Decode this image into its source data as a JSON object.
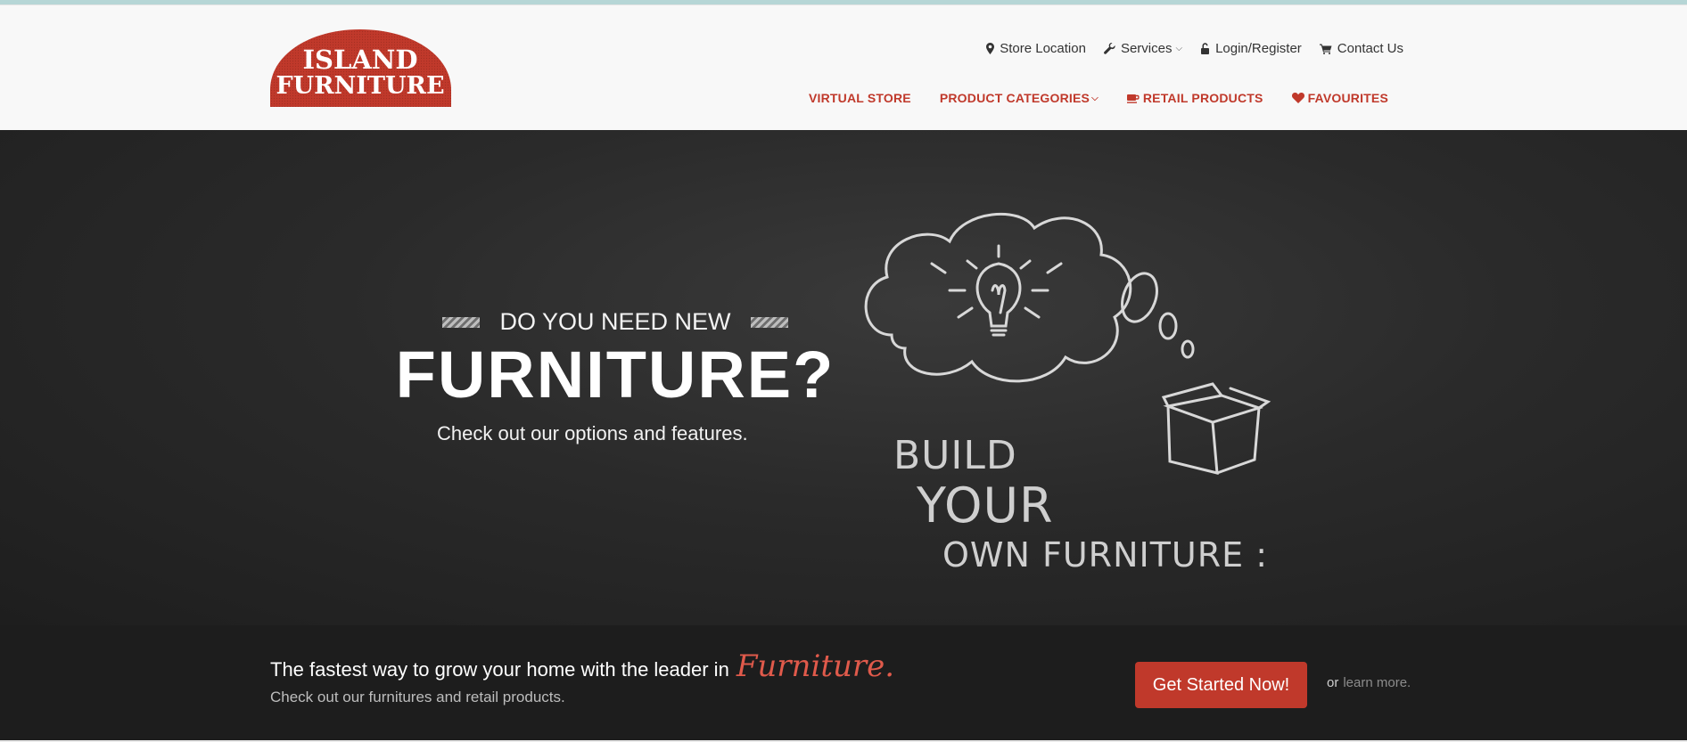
{
  "brand": {
    "logo_line1": "ISLAND",
    "logo_line2": "FURNITURE",
    "color": "#c0392b"
  },
  "utility_nav": [
    {
      "label": "Store Location",
      "icon": "map-marker-icon"
    },
    {
      "label": "Services",
      "icon": "wrench-icon",
      "has_dropdown": true
    },
    {
      "label": "Login/Register",
      "icon": "unlock-icon"
    },
    {
      "label": "Contact Us",
      "icon": "cart-icon"
    }
  ],
  "main_nav": [
    {
      "label": "VIRTUAL STORE"
    },
    {
      "label": "PRODUCT CATEGORIES",
      "has_dropdown": true
    },
    {
      "label": "RETAIL PRODUCTS",
      "icon": "coffee-cup-icon"
    },
    {
      "label": "FAVOURITES",
      "icon": "heart-icon"
    }
  ],
  "hero": {
    "eyebrow": "DO YOU NEED NEW",
    "headline": "FURNITURE?",
    "subline": "Check out our options and features.",
    "build_line1": "BUILD",
    "build_line2": "YOUR",
    "build_line3": "OWN FURNITURE :"
  },
  "cta": {
    "main_text": "The fastest way to grow your home with the leader in",
    "accent_text": "Furniture.",
    "sub_text": "Check out our furnitures and retail products.",
    "button_label": "Get Started Now!",
    "or_text": "or",
    "learn_more": "learn more."
  },
  "colors": {
    "accent": "#c0392b",
    "hero_bg": "#2a2a2a",
    "cta_bg": "#1d1d1d"
  }
}
